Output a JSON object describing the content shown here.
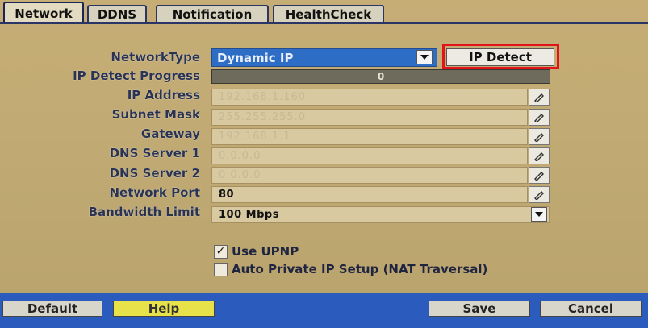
{
  "tabs": [
    {
      "label": "Network",
      "active": true
    },
    {
      "label": "DDNS",
      "active": false
    },
    {
      "label": "Notification",
      "active": false
    },
    {
      "label": "HealthCheck",
      "active": false
    }
  ],
  "form": {
    "network_type": {
      "label": "NetworkType",
      "value": "Dynamic IP"
    },
    "ip_detect_button": "IP Detect",
    "ip_detect_progress": {
      "label": "IP Detect Progress",
      "value": "0"
    },
    "ip_address": {
      "label": "IP Address",
      "value": "192.168.1.160"
    },
    "subnet_mask": {
      "label": "Subnet Mask",
      "value": "255.255.255.0"
    },
    "gateway": {
      "label": "Gateway",
      "value": "192.168.1.1"
    },
    "dns_server_1": {
      "label": "DNS Server 1",
      "value": "0.0.0.0"
    },
    "dns_server_2": {
      "label": "DNS Server 2",
      "value": "0.0.0.0"
    },
    "network_port": {
      "label": "Network Port",
      "value": "80"
    },
    "bandwidth_limit": {
      "label": "Bandwidth Limit",
      "value": "100 Mbps"
    }
  },
  "options": {
    "use_upnp": {
      "label": "Use UPNP",
      "checked": true,
      "check_mark": "✓"
    },
    "auto_private_ip": {
      "label": "Auto Private IP Setup (NAT Traversal)",
      "checked": false
    }
  },
  "bottom": {
    "default": "Default",
    "help": "Help",
    "save": "Save",
    "cancel": "Cancel"
  },
  "colors": {
    "panel_bg": "#c1aa73",
    "bottom_bar": "#2b5bbd",
    "highlight_outline": "#e0141a",
    "select_bg": "#2d6dc6",
    "help_button": "#e8e24a"
  },
  "icons": {
    "edit": "pencil-icon",
    "dropdown": "chevron-down-icon"
  }
}
